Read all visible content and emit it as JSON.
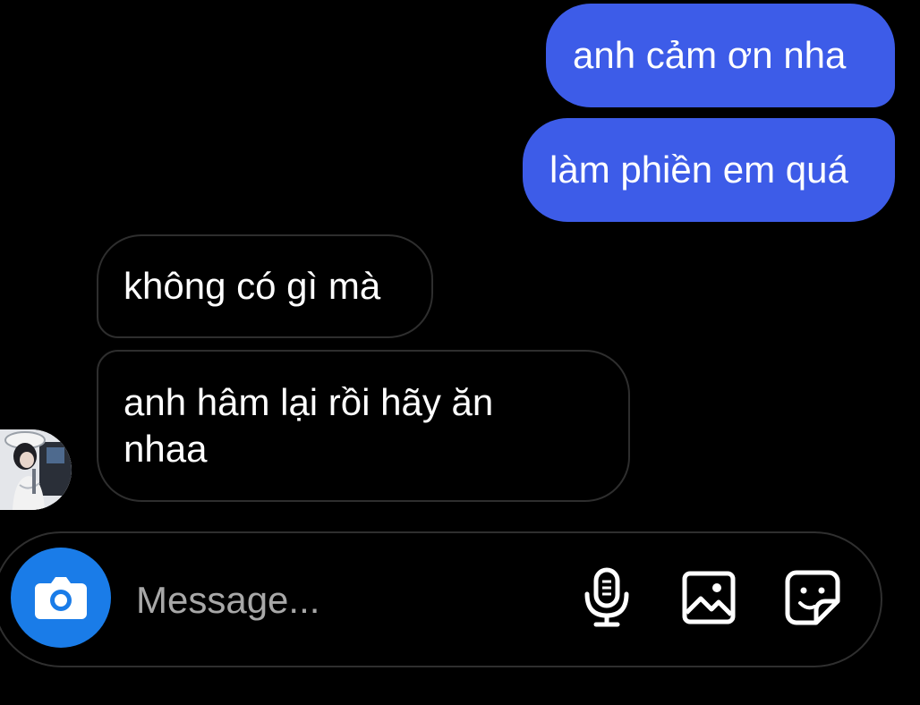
{
  "colors": {
    "background": "#000000",
    "sent_bubble": "#3d5ce8",
    "received_border": "#2e2e2e",
    "camera_button": "#1a7ce8",
    "placeholder": "#a8a8a8"
  },
  "messages": [
    {
      "direction": "sent",
      "text": "anh cảm ơn nha"
    },
    {
      "direction": "sent",
      "text": "làm phiền em quá"
    },
    {
      "direction": "received",
      "text": "không có gì mà"
    },
    {
      "direction": "received",
      "text": "anh hâm lại rồi hãy ăn\nnhaa"
    }
  ],
  "composer": {
    "placeholder": "Message...",
    "left_button_icon": "camera-icon",
    "right_icons": [
      "microphone-icon",
      "gallery-icon",
      "sticker-icon"
    ]
  }
}
